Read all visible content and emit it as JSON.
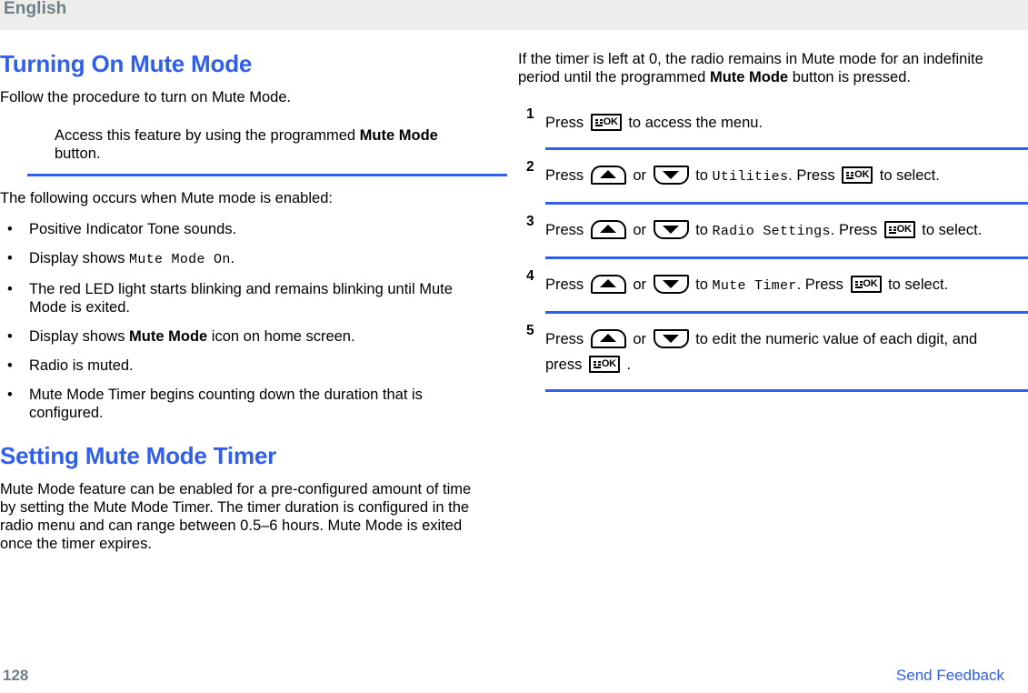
{
  "header": {
    "language": "English"
  },
  "left_column": {
    "section1": {
      "title": "Turning On Mute Mode",
      "intro": "Follow the procedure to turn on Mute Mode.",
      "note": {
        "text_before": "Access this feature by using the programmed ",
        "bold": "Mute Mode",
        "text_after": " button."
      },
      "list_lead": "The following occurs when Mute mode is enabled:",
      "bullets": [
        {
          "parts": [
            {
              "t": "Positive Indicator Tone sounds.",
              "style": "normal"
            }
          ]
        },
        {
          "parts": [
            {
              "t": "Display shows ",
              "style": "normal"
            },
            {
              "t": "Mute Mode On",
              "style": "mono"
            },
            {
              "t": ".",
              "style": "normal"
            }
          ]
        },
        {
          "parts": [
            {
              "t": "The red LED light starts blinking and remains blinking until Mute Mode is exited.",
              "style": "normal"
            }
          ]
        },
        {
          "parts": [
            {
              "t": "Display shows ",
              "style": "normal"
            },
            {
              "t": "Mute Mode",
              "style": "bold"
            },
            {
              "t": " icon on home screen.",
              "style": "normal"
            }
          ]
        },
        {
          "parts": [
            {
              "t": "Radio is muted.",
              "style": "normal"
            }
          ]
        },
        {
          "parts": [
            {
              "t": "Mute Mode Timer begins counting down the duration that is configured.",
              "style": "normal"
            }
          ]
        }
      ],
      "bullet_glyph": "•"
    },
    "section2": {
      "title": "Setting Mute Mode Timer",
      "body": "Mute Mode feature can be enabled for a pre-configured amount of time by setting the Mute Mode Timer. The timer duration is configured in the radio menu and can range between 0.5–6 hours. Mute Mode is exited once the timer expires."
    }
  },
  "right_column": {
    "intro": {
      "text_before": "If the timer is left at 0, the radio remains in Mute mode for an indefinite period until the programmed ",
      "bold": "Mute Mode",
      "text_after": " button is pressed."
    },
    "steps": [
      {
        "number": "1",
        "parts": [
          {
            "t": "Press ",
            "style": "normal"
          },
          {
            "t": "ok-key-icon",
            "style": "key-ok"
          },
          {
            "t": " to access the menu.",
            "style": "normal"
          }
        ]
      },
      {
        "number": "2",
        "parts": [
          {
            "t": "Press ",
            "style": "normal"
          },
          {
            "t": "arrow-up-key-icon",
            "style": "key-up"
          },
          {
            "t": " or ",
            "style": "normal"
          },
          {
            "t": "arrow-down-key-icon",
            "style": "key-down"
          },
          {
            "t": " to ",
            "style": "normal"
          },
          {
            "t": "Utilities",
            "style": "mono"
          },
          {
            "t": ". Press ",
            "style": "normal"
          },
          {
            "t": "ok-key-icon",
            "style": "key-ok"
          },
          {
            "t": " to select.",
            "style": "normal"
          }
        ]
      },
      {
        "number": "3",
        "parts": [
          {
            "t": "Press ",
            "style": "normal"
          },
          {
            "t": "arrow-up-key-icon",
            "style": "key-up"
          },
          {
            "t": " or ",
            "style": "normal"
          },
          {
            "t": "arrow-down-key-icon",
            "style": "key-down"
          },
          {
            "t": " to ",
            "style": "normal"
          },
          {
            "t": "Radio Settings",
            "style": "mono"
          },
          {
            "t": ". Press ",
            "style": "normal"
          },
          {
            "t": "ok-key-icon",
            "style": "key-ok"
          },
          {
            "t": " to select.",
            "style": "normal"
          }
        ]
      },
      {
        "number": "4",
        "parts": [
          {
            "t": "Press ",
            "style": "normal"
          },
          {
            "t": "arrow-up-key-icon",
            "style": "key-up"
          },
          {
            "t": " or ",
            "style": "normal"
          },
          {
            "t": "arrow-down-key-icon",
            "style": "key-down"
          },
          {
            "t": " to ",
            "style": "normal"
          },
          {
            "t": "Mute Timer",
            "style": "mono"
          },
          {
            "t": ". Press ",
            "style": "normal"
          },
          {
            "t": "ok-key-icon",
            "style": "key-ok"
          },
          {
            "t": " to select.",
            "style": "normal"
          }
        ]
      },
      {
        "number": "5",
        "parts": [
          {
            "t": "Press ",
            "style": "normal"
          },
          {
            "t": "arrow-up-key-icon",
            "style": "key-up"
          },
          {
            "t": " or ",
            "style": "normal"
          },
          {
            "t": "arrow-down-key-icon",
            "style": "key-down"
          },
          {
            "t": " to edit the numeric value of each digit, and press ",
            "style": "normal"
          },
          {
            "t": "ok-key-icon",
            "style": "key-ok"
          },
          {
            "t": " .",
            "style": "normal"
          }
        ]
      }
    ]
  },
  "footer": {
    "page_number": "128",
    "feedback_label": "Send Feedback"
  },
  "colors": {
    "accent_blue": "#2f5fec",
    "header_gray": "#6e8087",
    "header_band": "#ededeb"
  },
  "icons": {
    "ok_key_label": "OK"
  }
}
